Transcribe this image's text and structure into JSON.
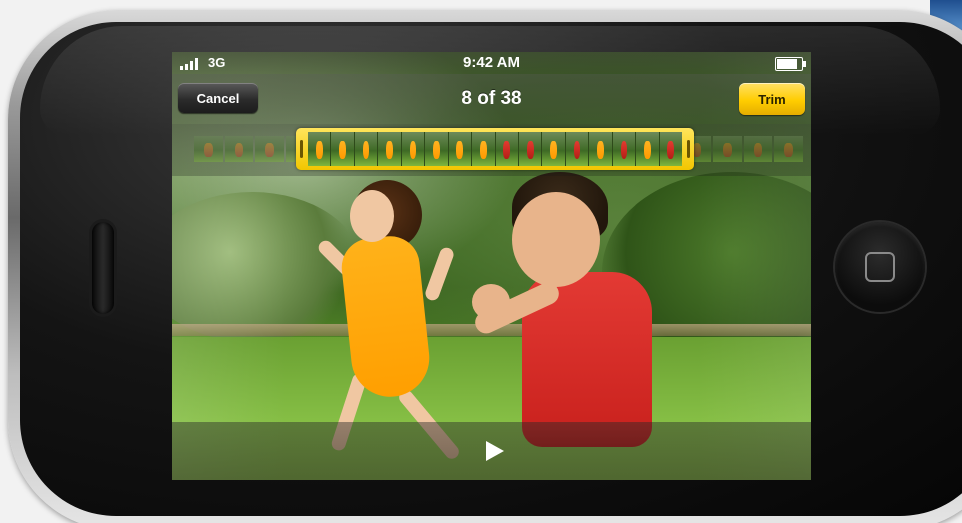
{
  "status_bar": {
    "carrier": "3G",
    "time": "9:42 AM"
  },
  "nav": {
    "cancel_label": "Cancel",
    "title": "8 of 38",
    "trim_label": "Trim"
  },
  "icons": {
    "signal": "signal-bars-icon",
    "battery": "battery-icon",
    "play": "play-icon",
    "home": "home-button-icon"
  },
  "colors": {
    "trim_accent": "#FFCD00",
    "nav_bar": "#2b2b2b"
  }
}
